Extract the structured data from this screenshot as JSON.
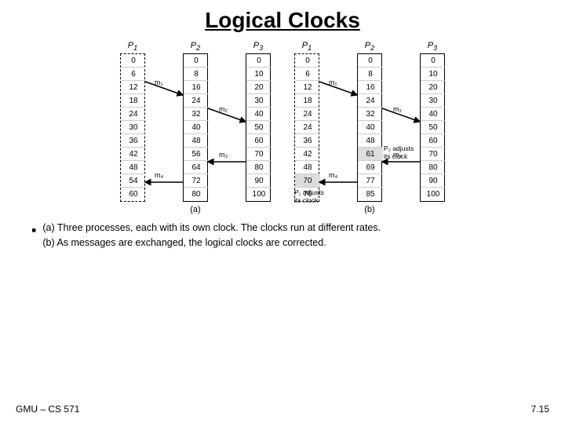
{
  "title": "Logical Clocks",
  "diagram_a": {
    "label": "(a)",
    "processes": [
      {
        "name": "P1",
        "dashed": true,
        "values": [
          "0",
          "6",
          "12",
          "18",
          "24",
          "30",
          "36",
          "42",
          "48",
          "54",
          "60"
        ]
      },
      {
        "name": "P2",
        "dashed": false,
        "values": [
          "0",
          "8",
          "16",
          "24",
          "32",
          "40",
          "48",
          "56",
          "64",
          "72",
          "80"
        ]
      },
      {
        "name": "P3",
        "dashed": false,
        "values": [
          "0",
          "10",
          "20",
          "30",
          "40",
          "50",
          "60",
          "70",
          "80",
          "90",
          "100"
        ]
      }
    ],
    "messages": [
      "m1",
      "m2",
      "m3",
      "m4"
    ]
  },
  "diagram_b": {
    "label": "(b)",
    "processes": [
      {
        "name": "P1",
        "dashed": true,
        "values": [
          "0",
          "6",
          "12",
          "18",
          "24",
          "24",
          "36",
          "42",
          "48",
          "70",
          "76"
        ]
      },
      {
        "name": "P2",
        "dashed": false,
        "values": [
          "0",
          "8",
          "16",
          "24",
          "32",
          "40",
          "48",
          "61",
          "69",
          "77",
          "85"
        ]
      },
      {
        "name": "P3",
        "dashed": false,
        "values": [
          "0",
          "10",
          "20",
          "30",
          "40",
          "50",
          "60",
          "70",
          "80",
          "90",
          "100"
        ]
      }
    ],
    "messages": [
      "m1",
      "m2",
      "m3",
      "m4"
    ],
    "notes": [
      "P2 adjusts\nits clock",
      "P1 adjusts\nits clock"
    ]
  },
  "caption": {
    "bullet": "▪",
    "line1": "(a) Three processes, each with its own clock. The clocks run at different rates.",
    "line2": "(b) As messages are exchanged, the logical clocks are corrected."
  },
  "footer": {
    "left": "GMU – CS 571",
    "right": "7.15"
  }
}
